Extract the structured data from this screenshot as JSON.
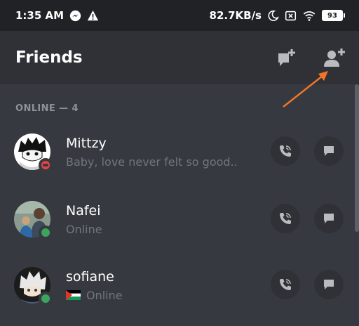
{
  "status_bar": {
    "time": "1:35 AM",
    "net_speed": "82.7KB/s",
    "battery": "93"
  },
  "header": {
    "title": "Friends"
  },
  "section": {
    "label": "ONLINE — 4"
  },
  "friends": [
    {
      "name": "Mittzy",
      "status_text": "Baby, love never felt so good..",
      "presence": "dnd"
    },
    {
      "name": "Nafei",
      "status_text": "Online",
      "presence": "online"
    },
    {
      "name": "sofiane",
      "status_text": "Online",
      "presence": "online",
      "flag": "palestine-flag"
    }
  ],
  "colors": {
    "background": "#36393f",
    "header_bg": "#2f3136",
    "status_bar_bg": "#202225",
    "online": "#3ba55d",
    "dnd": "#ed4245",
    "annotation_arrow": "#f0752b"
  }
}
